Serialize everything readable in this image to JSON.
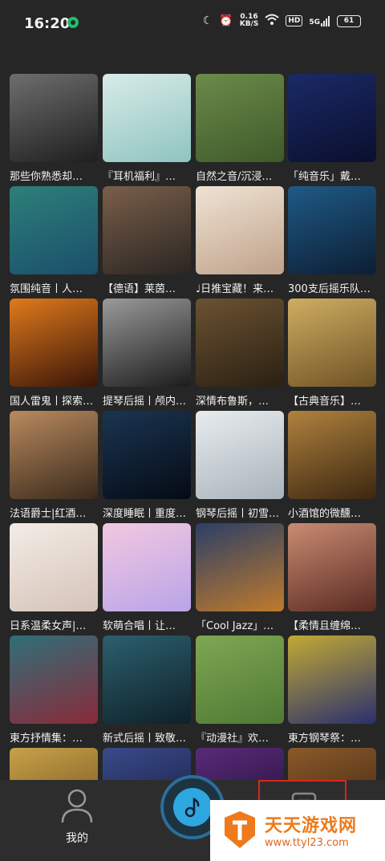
{
  "status_bar": {
    "time": "16:20",
    "net_speed_value": "0.16",
    "net_speed_unit": "KB/S",
    "hd": "HD",
    "signal": "5G",
    "battery": "61"
  },
  "playlists": [
    {
      "title": "那些你熟悉却…",
      "colors": [
        "#6e6e6e",
        "#1e1e1e"
      ]
    },
    {
      "title": "『耳机福利』…",
      "colors": [
        "#d8ebe8",
        "#8fc4c0"
      ]
    },
    {
      "title": "自然之音/沉浸…",
      "colors": [
        "#6c8a4a",
        "#3f5a2a"
      ]
    },
    {
      "title": "「纯音乐」戴…",
      "colors": [
        "#1b2a66",
        "#0a0f2e"
      ]
    },
    {
      "title": "氛围纯音丨人…",
      "colors": [
        "#2d7f79",
        "#1a4f6b"
      ]
    },
    {
      "title": "【德语】莱茵…",
      "colors": [
        "#7a5f4a",
        "#2a2522"
      ]
    },
    {
      "title": "♩日推宝藏！来…",
      "colors": [
        "#efe3d4",
        "#bfa28a"
      ]
    },
    {
      "title": "300支后摇乐队…",
      "colors": [
        "#1f5a86",
        "#0c1e33"
      ]
    },
    {
      "title": "国人雷鬼丨探索…",
      "colors": [
        "#e07a1c",
        "#3a1508"
      ]
    },
    {
      "title": "提琴后摇丨颅内…",
      "colors": [
        "#9a9a9a",
        "#1c1c1c"
      ]
    },
    {
      "title": "深情布鲁斯，…",
      "colors": [
        "#6b5232",
        "#2a2012"
      ]
    },
    {
      "title": "【古典音乐】…",
      "colors": [
        "#cfae62",
        "#6e5224"
      ]
    },
    {
      "title": "法语爵士|红酒…",
      "colors": [
        "#b98a5e",
        "#3a2a1c"
      ]
    },
    {
      "title": "深度睡眠丨重度…",
      "colors": [
        "#1a3552",
        "#050b14"
      ]
    },
    {
      "title": "钢琴后摇丨初雪…",
      "colors": [
        "#e8ecef",
        "#a9b3ba"
      ]
    },
    {
      "title": "小酒馆的微醺…",
      "colors": [
        "#b0823f",
        "#3b2710"
      ]
    },
    {
      "title": "日系温柔女声|…",
      "colors": [
        "#f3ece6",
        "#d5c3b8"
      ]
    },
    {
      "title": "软萌合唱丨让…",
      "colors": [
        "#f2c8e0",
        "#b9a4e8"
      ]
    },
    {
      "title": "「Cool Jazz」…",
      "colors": [
        "#2b3f66",
        "#c07a2c"
      ]
    },
    {
      "title": "【柔情且缠绵…",
      "colors": [
        "#c98c72",
        "#5a2a22"
      ]
    },
    {
      "title": "東方抒情集：…",
      "colors": [
        "#2f6f78",
        "#8a2a3a"
      ]
    },
    {
      "title": "新式后摇丨致敬…",
      "colors": [
        "#2c5f6e",
        "#0e2129"
      ]
    },
    {
      "title": "『动漫社』欢…",
      "colors": [
        "#7fa653",
        "#4f7a34"
      ]
    },
    {
      "title": "東方钢琴祭：…",
      "colors": [
        "#c2aa33",
        "#2a2f6e"
      ]
    },
    {
      "title": "",
      "colors": [
        "#c8a24a",
        "#6a4a1a"
      ]
    },
    {
      "title": "",
      "colors": [
        "#3a4a8a",
        "#141a3a"
      ]
    },
    {
      "title": "",
      "colors": [
        "#5a2a7a",
        "#1a0f2e"
      ]
    },
    {
      "title": "",
      "colors": [
        "#8a5a2a",
        "#3a2010"
      ]
    }
  ],
  "tabbar": {
    "me_label": "我的"
  },
  "watermark": {
    "brand": "天天游戏网",
    "url": "www.ttyl23.com"
  }
}
